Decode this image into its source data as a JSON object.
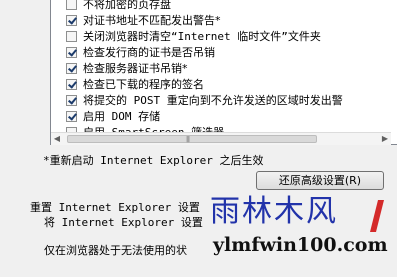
{
  "settings": {
    "items": [
      {
        "label": "不将加密的页存盘",
        "checked": false
      },
      {
        "label": "对证书地址不匹配发出警告*",
        "checked": true
      },
      {
        "label": "关闭浏览器时清空“Internet 临时文件”文件夹",
        "checked": false
      },
      {
        "label": "检查发行商的证书是否吊销",
        "checked": true
      },
      {
        "label": "检查服务器证书吊销*",
        "checked": true
      },
      {
        "label": "检查已下载的程序的签名",
        "checked": true
      },
      {
        "label": "将提交的 POST 重定向到不允许发送的区域时发出警",
        "checked": true
      },
      {
        "label": "启用 DOM 存储",
        "checked": true
      },
      {
        "label": "启用 SmartScreen 筛选器",
        "checked": false
      }
    ]
  },
  "note": "*重新启动 Internet Explorer 之后生效",
  "restore_button": "还原高级设置(R)",
  "reset_section": {
    "title": "重置 Internet Explorer 设置",
    "desc": "将 Internet Explorer 设置",
    "browser_note": "仅在浏览器处于无法使用的状"
  },
  "watermark": {
    "title": "雨林木风",
    "url": "ylmfwin100.com"
  }
}
